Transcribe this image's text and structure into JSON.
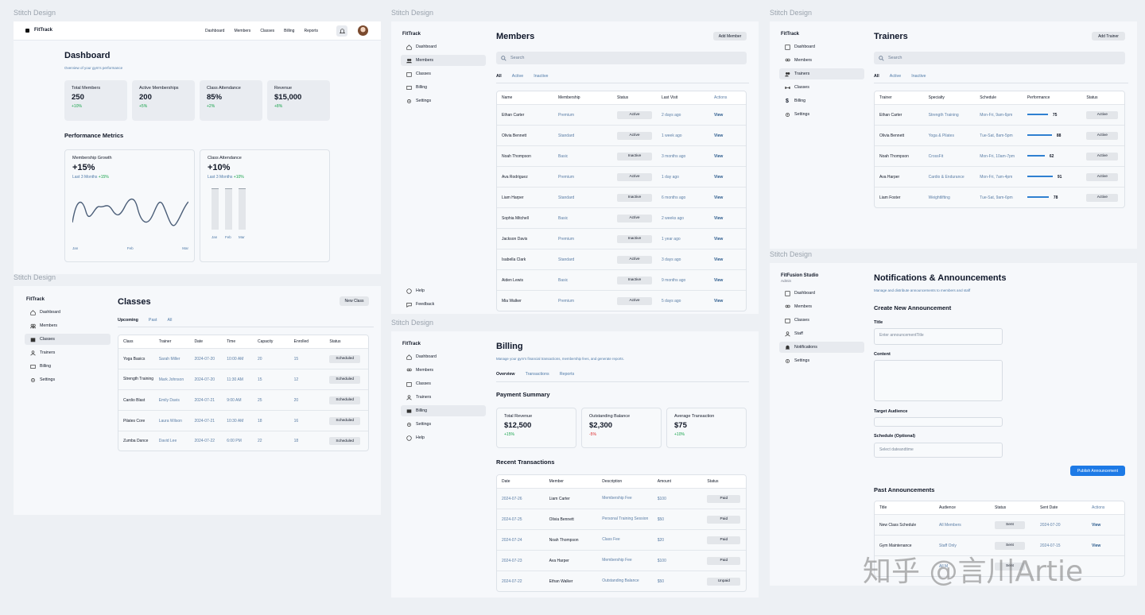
{
  "frame_label": "Stitch Design",
  "dashboard": {
    "brand": "FitTrack",
    "nav": [
      "Dashboard",
      "Members",
      "Classes",
      "Billing",
      "Reports"
    ],
    "title": "Dashboard",
    "subtitle": "Overview of your gym's performance",
    "stats": [
      {
        "label": "Total Members",
        "value": "250",
        "change": "+10%"
      },
      {
        "label": "Active Memberships",
        "value": "200",
        "change": "+5%"
      },
      {
        "label": "Class Attendance",
        "value": "85%",
        "change": "+2%"
      },
      {
        "label": "Revenue",
        "value": "$15,000",
        "change": "+8%"
      }
    ],
    "metrics_title": "Performance Metrics",
    "growth": {
      "title": "Membership Growth",
      "value": "+15%",
      "period": "Last 3 Months",
      "change": "+15%",
      "xlabels": [
        "Jan",
        "Feb",
        "Mar"
      ]
    },
    "attendance": {
      "title": "Class Attendance",
      "value": "+10%",
      "period": "Last 3 Months",
      "change": "+10%",
      "xlabels": [
        "Jan",
        "Feb",
        "Mar"
      ]
    }
  },
  "members": {
    "brand": "FitTrack",
    "sidebar": [
      "Dashboard",
      "Members",
      "Classes",
      "Billing",
      "Settings"
    ],
    "sidebar_bottom": [
      "Help",
      "Feedback"
    ],
    "title": "Members",
    "add_button": "Add Member",
    "search_placeholder": "Search",
    "tabs": [
      "All",
      "Active",
      "Inactive"
    ],
    "columns": [
      "Name",
      "Membership",
      "Status",
      "Last Visit",
      "Actions"
    ],
    "rows": [
      [
        "Ethan Carter",
        "Premium",
        "Active",
        "2 days ago",
        "View"
      ],
      [
        "Olivia Bennett",
        "Standard",
        "Active",
        "1 week ago",
        "View"
      ],
      [
        "Noah Thompson",
        "Basic",
        "Inactive",
        "3 months ago",
        "View"
      ],
      [
        "Ava Rodriguez",
        "Premium",
        "Active",
        "1 day ago",
        "View"
      ],
      [
        "Liam Harper",
        "Standard",
        "Inactive",
        "6 months ago",
        "View"
      ],
      [
        "Sophia Mitchell",
        "Basic",
        "Active",
        "2 weeks ago",
        "View"
      ],
      [
        "Jackson Davis",
        "Premium",
        "Inactive",
        "1 year ago",
        "View"
      ],
      [
        "Isabella Clark",
        "Standard",
        "Active",
        "3 days ago",
        "View"
      ],
      [
        "Aiden Lewis",
        "Basic",
        "Inactive",
        "9 months ago",
        "View"
      ],
      [
        "Mia Walker",
        "Premium",
        "Active",
        "5 days ago",
        "View"
      ]
    ]
  },
  "trainers": {
    "brand": "FitTrack",
    "sidebar": [
      "Dashboard",
      "Members",
      "Trainers",
      "Classes",
      "Billing",
      "Settings"
    ],
    "title": "Trainers",
    "add_button": "Add Trainer",
    "search_placeholder": "Search",
    "tabs": [
      "All",
      "Active",
      "Inactive"
    ],
    "columns": [
      "Trainer",
      "Specialty",
      "Schedule",
      "Performance",
      "Status"
    ],
    "rows": [
      [
        "Ethan Carter",
        "Strength Training",
        "Mon-Fri, 9am-6pm",
        "75",
        "Active"
      ],
      [
        "Olivia Bennett",
        "Yoga & Pilates",
        "Tue-Sat, 8am-5pm",
        "88",
        "Active"
      ],
      [
        "Noah Thompson",
        "CrossFit",
        "Mon-Fri, 10am-7pm",
        "62",
        "Active"
      ],
      [
        "Ava Harper",
        "Cardio & Endurance",
        "Mon-Fri, 7am-4pm",
        "91",
        "Active"
      ],
      [
        "Liam Foster",
        "Weightlifting",
        "Tue-Sat, 9am-6pm",
        "78",
        "Active"
      ]
    ]
  },
  "classes": {
    "brand": "FitTrack",
    "sidebar": [
      "Dashboard",
      "Members",
      "Classes",
      "Trainers",
      "Billing",
      "Settings"
    ],
    "title": "Classes",
    "new_button": "New Class",
    "tabs": [
      "Upcoming",
      "Past",
      "All"
    ],
    "columns": [
      "Class",
      "Trainer",
      "Date",
      "Time",
      "Capacity",
      "Enrolled",
      "Status"
    ],
    "rows": [
      [
        "Yoga Basics",
        "Sarah Miller",
        "2024-07-20",
        "10:00 AM",
        "20",
        "15",
        "Scheduled"
      ],
      [
        "Strength Training",
        "Mark Johnson",
        "2024-07-20",
        "11:30 AM",
        "15",
        "12",
        "Scheduled"
      ],
      [
        "Cardio Blast",
        "Emily Davis",
        "2024-07-21",
        "9:00 AM",
        "25",
        "20",
        "Scheduled"
      ],
      [
        "Pilates Core",
        "Laura Wilson",
        "2024-07-21",
        "10:30 AM",
        "18",
        "16",
        "Scheduled"
      ],
      [
        "Zumba Dance",
        "David Lee",
        "2024-07-22",
        "6:00 PM",
        "22",
        "18",
        "Scheduled"
      ]
    ]
  },
  "billing": {
    "brand": "FitTrack",
    "sidebar": [
      "Dashboard",
      "Members",
      "Classes",
      "Trainers",
      "Billing",
      "Settings",
      "Help"
    ],
    "title": "Billing",
    "subtitle": "Manage your gym's financial transactions, membership fees, and generate reports.",
    "tabs": [
      "Overview",
      "Transactions",
      "Reports"
    ],
    "summary_title": "Payment Summary",
    "summary": [
      {
        "label": "Total Revenue",
        "value": "$12,500",
        "change": "+15%"
      },
      {
        "label": "Outstanding Balance",
        "value": "$2,300",
        "change": "-5%"
      },
      {
        "label": "Average Transaction",
        "value": "$75",
        "change": "+10%"
      }
    ],
    "recent_title": "Recent Transactions",
    "columns": [
      "Date",
      "Member",
      "Description",
      "Amount",
      "Status"
    ],
    "rows": [
      [
        "2024-07-26",
        "Liam Carter",
        "Membership Fee",
        "$100",
        "Paid"
      ],
      [
        "2024-07-25",
        "Olivia Bennett",
        "Personal Training Session",
        "$50",
        "Paid"
      ],
      [
        "2024-07-24",
        "Noah Thompson",
        "Class Fee",
        "$20",
        "Paid"
      ],
      [
        "2024-07-23",
        "Ava Harper",
        "Membership Fee",
        "$100",
        "Paid"
      ],
      [
        "2024-07-22",
        "Ethan Walker",
        "Outstanding Balance",
        "$50",
        "Unpaid"
      ]
    ]
  },
  "notifications": {
    "brand": "FitFusion Studio",
    "role": "Admin",
    "sidebar": [
      "Dashboard",
      "Members",
      "Classes",
      "Staff",
      "Notifications",
      "Settings"
    ],
    "title": "Notifications & Announcements",
    "subtitle": "Manage and distribute announcements to members and staff",
    "create_title": "Create New Announcement",
    "title_label": "Title",
    "title_placeholder": "Enter announcementTitle",
    "content_label": "Content",
    "audience_label": "Target Audience",
    "schedule_label": "Schedule (Optional)",
    "schedule_placeholder": "Select dateandtime",
    "publish_button": "Publish Announcement",
    "past_title": "Past Announcements",
    "columns": [
      "Title",
      "Audience",
      "Status",
      "Sent Date",
      "Actions"
    ],
    "rows": [
      [
        "New Class Schedule",
        "All Members",
        "Sent",
        "2024-07-20",
        "View"
      ],
      [
        "Gym Maintenance",
        "Staff Only",
        "Sent",
        "2024-07-15",
        "View"
      ],
      [
        "",
        "All M",
        "Sent",
        "",
        ""
      ]
    ]
  },
  "watermark": "知乎 @言川Artie"
}
